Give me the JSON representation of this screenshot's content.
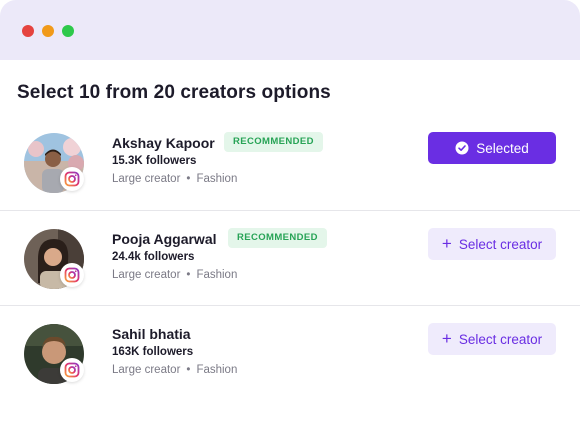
{
  "window": {
    "controls": [
      "close",
      "minimize",
      "maximize"
    ]
  },
  "heading": "Select 10 from 20 creators options",
  "creators": [
    {
      "name": "Akshay Kapoor",
      "badge": "RECOMMENDED",
      "followers": "15.3K followers",
      "size": "Large creator",
      "category": "Fashion",
      "platform_icon": "instagram-icon",
      "button": {
        "label": "Selected",
        "state": "selected",
        "icon": "check-circle-icon"
      }
    },
    {
      "name": "Pooja Aggarwal",
      "badge": "RECOMMENDED",
      "followers": "24.4k followers",
      "size": "Large creator",
      "category": "Fashion",
      "platform_icon": "instagram-icon",
      "button": {
        "label": "Select creator",
        "state": "unselected",
        "icon": "plus-icon"
      }
    },
    {
      "name": "Sahil bhatia",
      "badge": "",
      "followers": "163K followers",
      "size": "Large creator",
      "category": "Fashion",
      "platform_icon": "instagram-icon",
      "button": {
        "label": "Select creator",
        "state": "unselected",
        "icon": "plus-icon"
      }
    }
  ],
  "colors": {
    "titlebar": "#ece9f9",
    "accent": "#6a2ee3",
    "accent_light": "#efebfc",
    "badge_bg": "#e4f6ea",
    "badge_text": "#27a356"
  }
}
